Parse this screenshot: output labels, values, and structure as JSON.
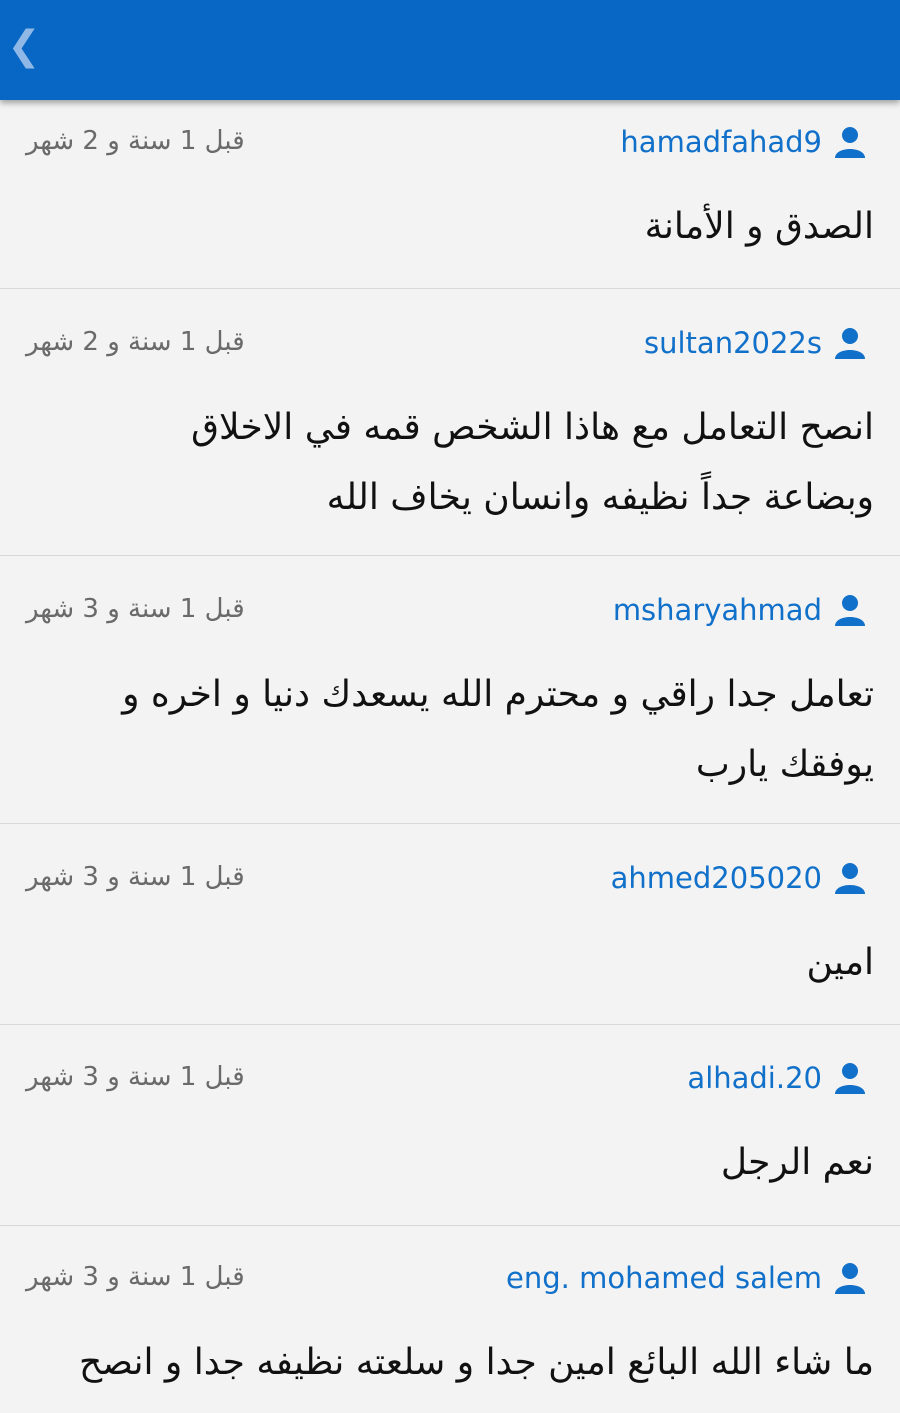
{
  "header": {
    "back_glyph": "❮",
    "color": "#0867c4"
  },
  "reviews": [
    {
      "user": "hamadfahad9",
      "time": "قبل 1 سنة و 2 شهر",
      "text": "الصدق و الأمانة"
    },
    {
      "user": "sultan2022s",
      "time": "قبل 1 سنة و 2 شهر",
      "text": "انصح التعامل مع هاذا الشخص قمه في الاخلاق وبضاعة جداً نظيفه وانسان يخاف الله"
    },
    {
      "user": "msharyahmad",
      "time": "قبل 1 سنة و 3 شهر",
      "text": "تعامل جدا راقي و محترم الله يسعدك دنيا و اخره و يوفقك يارب"
    },
    {
      "user": "ahmed205020",
      "time": "قبل 1 سنة و 3 شهر",
      "text": "امين"
    },
    {
      "user": "alhadi.20",
      "time": "قبل 1 سنة و 3 شهر",
      "text": "نعم الرجل"
    },
    {
      "user": "eng. mohamed salem",
      "time": "قبل 1 سنة و 3 شهر",
      "text": "ما شاء الله البائع امين جدا و سلعته نظيفه جدا و انصح"
    }
  ],
  "colors": {
    "link": "#1170c9",
    "background": "#f3f3f3",
    "muted_text": "#6a6a6a"
  },
  "icons": {
    "back": "chevron-left-icon",
    "user": "user-icon"
  }
}
